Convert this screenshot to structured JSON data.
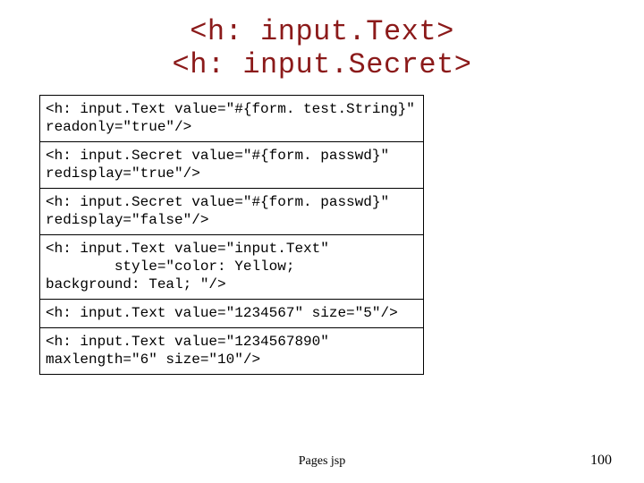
{
  "title": {
    "line1": "<h: input.Text>",
    "line2": "<h: input.Secret>"
  },
  "rows": [
    "<h: input.Text value=\"#{form. test.String}\" readonly=\"true\"/>",
    "<h: input.Secret value=\"#{form. passwd}\" redisplay=\"true\"/>",
    "<h: input.Secret value=\"#{form. passwd}\" redisplay=\"false\"/>",
    "<h: input.Text value=\"input.Text\"\n        style=\"color: Yellow;\nbackground: Teal; \"/>",
    "<h: input.Text value=\"1234567\" size=\"5\"/>",
    "<h: input.Text value=\"1234567890\" maxlength=\"6\" size=\"10\"/>"
  ],
  "footer": {
    "center": "Pages jsp",
    "page_number": "100"
  }
}
